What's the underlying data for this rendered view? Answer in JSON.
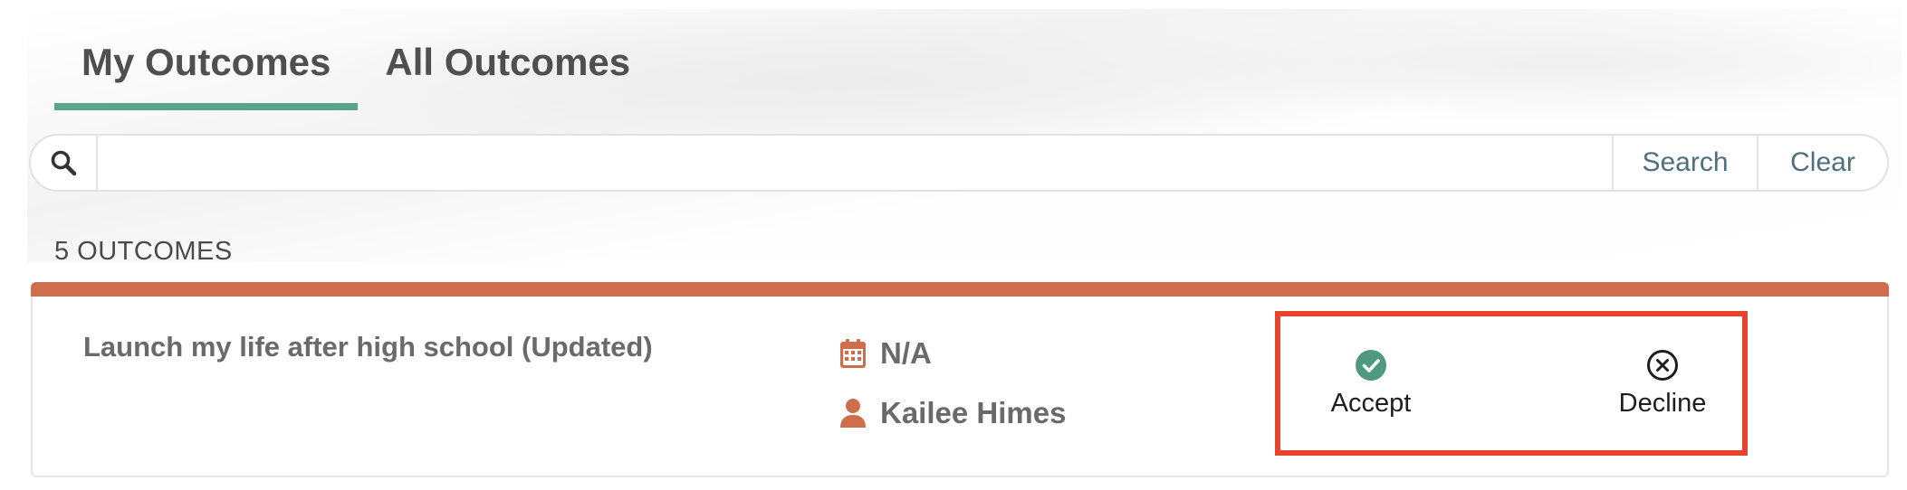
{
  "tabs": [
    {
      "label": "My Outcomes",
      "active": true
    },
    {
      "label": "All Outcomes",
      "active": false
    }
  ],
  "search": {
    "placeholder": "",
    "value": "",
    "search_label": "Search",
    "clear_label": "Clear",
    "icon": "search-icon"
  },
  "outcomes_count_label": "5 OUTCOMES",
  "outcome": {
    "title": "Launch my life after high school (Updated)",
    "date": "N/A",
    "date_icon": "calendar-icon",
    "owner": "Kailee Himes",
    "owner_icon": "person-icon",
    "accept_label": "Accept",
    "accept_icon": "check-circle-icon",
    "decline_label": "Decline",
    "decline_icon": "x-circle-icon"
  },
  "colors": {
    "tab_underline": "#5aa48a",
    "card_topbar": "#cf6e4c",
    "icon_orange": "#cf6e4c",
    "accept_green": "#4f9a7f",
    "highlight_box": "#e8432b",
    "button_text": "#4e6f7d"
  }
}
